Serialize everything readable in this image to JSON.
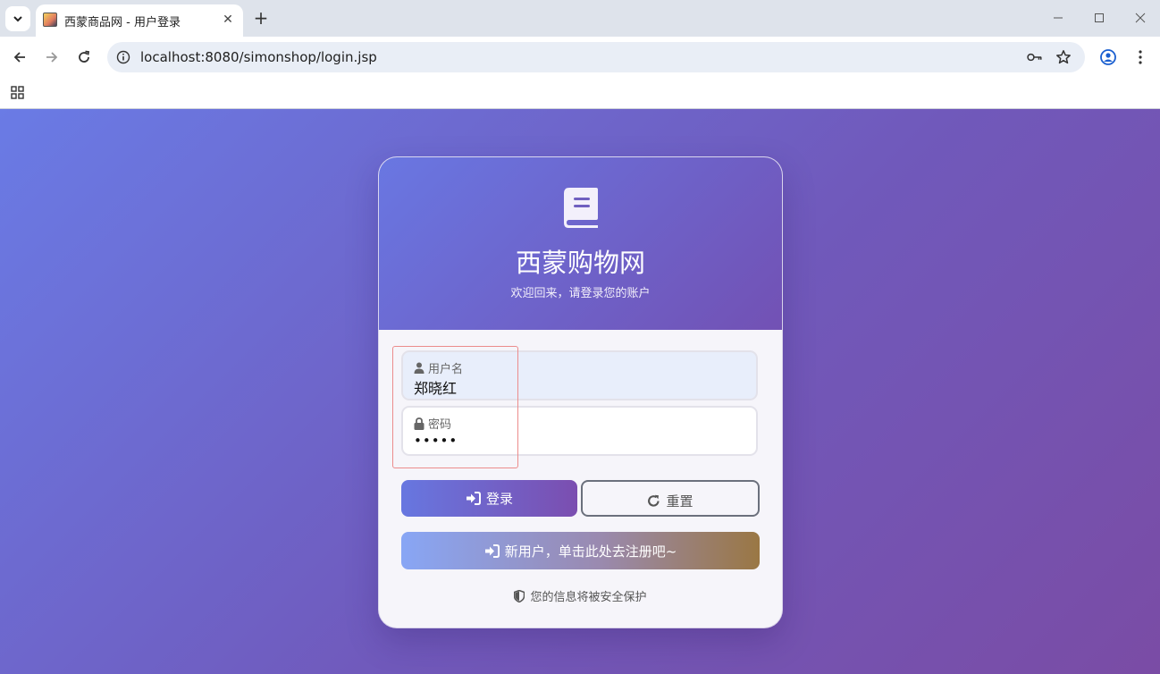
{
  "browser": {
    "tab_title": "西蒙商品网 - 用户登录",
    "url": "localhost:8080/simonshop/login.jsp"
  },
  "login": {
    "site_title": "西蒙购物网",
    "subtitle": "欢迎回来，请登录您的账户",
    "username_label": "用户名",
    "username_value": "郑晓红",
    "password_label": "密码",
    "password_value": "•••••",
    "login_button": "登录",
    "reset_button": "重置",
    "register_button": "新用户，单击此处去注册吧~",
    "security_note": "您的信息将被安全保护"
  },
  "colors": {
    "page_gradient_start": "#6a7be5",
    "page_gradient_end": "#7a4ca5",
    "header_gradient_start": "#6977e2",
    "header_gradient_end": "#7251b4",
    "card_bg": "#f6f5fa",
    "username_field_bg": "#e8eefb",
    "highlight_border": "#ec8c8c"
  }
}
